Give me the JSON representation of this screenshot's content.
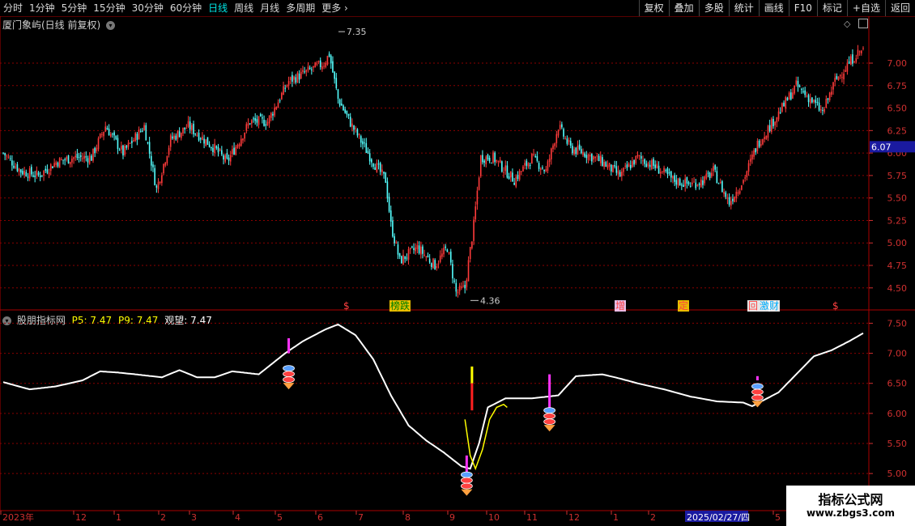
{
  "toolbar": {
    "periods": [
      "分时",
      "1分钟",
      "5分钟",
      "15分钟",
      "30分钟",
      "60分钟",
      "日线",
      "周线",
      "月线",
      "多周期",
      "更多"
    ],
    "active": "日线",
    "more_chevron": "›",
    "right_buttons": [
      "复权",
      "叠加",
      "多股",
      "统计",
      "画线",
      "F10",
      "标记",
      "+自选",
      "返回"
    ]
  },
  "main_panel": {
    "title": "厦门象屿(日线 前复权)",
    "price_labels": [
      "7.00",
      "6.75",
      "6.50",
      "6.25",
      "6.00",
      "5.75",
      "5.50",
      "5.25",
      "5.00",
      "4.75",
      "4.50"
    ],
    "current_price": "6.07",
    "high_label": "7.35",
    "low_label": "4.36",
    "markers": [
      "$",
      "榜跌",
      "增",
      "定",
      "回",
      "激",
      "财",
      "$"
    ]
  },
  "indicator_panel": {
    "name": "股朋指标网",
    "p5_label": "P5:",
    "p5": "7.47",
    "p9_label": "P9:",
    "p9": "7.47",
    "view_label": "观望:",
    "view": "7.47",
    "price_labels": [
      "7.50",
      "7.00",
      "6.50",
      "6.00",
      "5.50",
      "5.00"
    ]
  },
  "date_axis": {
    "labels": [
      "2023年",
      "12",
      "1",
      "2",
      "3",
      "4",
      "5",
      "6",
      "7",
      "8",
      "9",
      "10",
      "11",
      "12",
      "1",
      "2",
      "2025/02/27/四",
      "5"
    ]
  },
  "watermark": {
    "line1": "指标公式网",
    "line2": "www.zbgs3.com"
  },
  "colors": {
    "up": "#ff3b3b",
    "down": "#54ffff",
    "grid": "#8b0000",
    "axis_text": "#d03030",
    "indicator_line": "#ffffff",
    "signal_yellow": "#ffff00",
    "signal_magenta": "#ff33ff",
    "highlight_blue": "#1a1aa0"
  },
  "chart_data": {
    "type": "candlestick",
    "title": "厦门象屿(日线 前复权)",
    "ylim": [
      4.3,
      7.45
    ],
    "annotated_high": 7.35,
    "annotated_low": 4.36,
    "current_price": 6.07,
    "trend_points": [
      [
        0,
        6.0
      ],
      [
        10,
        5.8
      ],
      [
        20,
        5.75
      ],
      [
        30,
        5.9
      ],
      [
        40,
        5.95
      ],
      [
        50,
        5.95
      ],
      [
        58,
        6.3
      ],
      [
        68,
        6.0
      ],
      [
        80,
        6.3
      ],
      [
        87,
        5.6
      ],
      [
        95,
        6.15
      ],
      [
        105,
        6.3
      ],
      [
        120,
        6.05
      ],
      [
        127,
        5.9
      ],
      [
        140,
        6.35
      ],
      [
        150,
        6.35
      ],
      [
        162,
        6.8
      ],
      [
        172,
        6.9
      ],
      [
        182,
        7.0
      ],
      [
        185,
        7.1
      ],
      [
        190,
        6.6
      ],
      [
        198,
        6.3
      ],
      [
        210,
        5.9
      ],
      [
        217,
        5.7
      ],
      [
        220,
        5.2
      ],
      [
        225,
        4.8
      ],
      [
        235,
        4.95
      ],
      [
        245,
        4.75
      ],
      [
        252,
        4.95
      ],
      [
        257,
        4.45
      ],
      [
        262,
        4.5
      ],
      [
        267,
        5.2
      ],
      [
        271,
        5.95
      ],
      [
        278,
        5.95
      ],
      [
        290,
        5.7
      ],
      [
        300,
        5.95
      ],
      [
        308,
        5.8
      ],
      [
        315,
        6.3
      ],
      [
        322,
        6.05
      ],
      [
        330,
        6.0
      ],
      [
        340,
        5.9
      ],
      [
        350,
        5.75
      ],
      [
        360,
        5.95
      ],
      [
        370,
        5.85
      ],
      [
        380,
        5.7
      ],
      [
        390,
        5.65
      ],
      [
        398,
        5.7
      ],
      [
        403,
        5.8
      ],
      [
        408,
        5.6
      ],
      [
        412,
        5.45
      ],
      [
        420,
        5.7
      ],
      [
        428,
        6.1
      ],
      [
        435,
        6.3
      ],
      [
        442,
        6.5
      ],
      [
        450,
        6.75
      ],
      [
        458,
        6.6
      ],
      [
        465,
        6.45
      ],
      [
        472,
        6.8
      ],
      [
        478,
        6.95
      ],
      [
        484,
        7.1
      ],
      [
        488,
        7.15
      ]
    ],
    "indicator": {
      "name": "股朋指标网",
      "ylim": [
        4.8,
        7.6
      ],
      "P5": 7.47,
      "P9": 7.47,
      "观望": 7.47,
      "line_points": [
        [
          0,
          6.52
        ],
        [
          15,
          6.4
        ],
        [
          30,
          6.45
        ],
        [
          45,
          6.55
        ],
        [
          55,
          6.7
        ],
        [
          65,
          6.68
        ],
        [
          75,
          6.65
        ],
        [
          90,
          6.6
        ],
        [
          100,
          6.72
        ],
        [
          110,
          6.6
        ],
        [
          120,
          6.6
        ],
        [
          130,
          6.7
        ],
        [
          145,
          6.65
        ],
        [
          160,
          7.0
        ],
        [
          170,
          7.2
        ],
        [
          183,
          7.4
        ],
        [
          190,
          7.48
        ],
        [
          200,
          7.3
        ],
        [
          210,
          6.9
        ],
        [
          220,
          6.3
        ],
        [
          230,
          5.8
        ],
        [
          240,
          5.55
        ],
        [
          250,
          5.35
        ],
        [
          260,
          5.12
        ],
        [
          265,
          5.08
        ],
        [
          270,
          5.5
        ],
        [
          275,
          6.1
        ],
        [
          285,
          6.25
        ],
        [
          300,
          6.25
        ],
        [
          315,
          6.3
        ],
        [
          325,
          6.62
        ],
        [
          340,
          6.65
        ],
        [
          350,
          6.58
        ],
        [
          360,
          6.5
        ],
        [
          375,
          6.4
        ],
        [
          390,
          6.28
        ],
        [
          405,
          6.2
        ],
        [
          420,
          6.18
        ],
        [
          425,
          6.12
        ],
        [
          440,
          6.35
        ],
        [
          450,
          6.65
        ],
        [
          460,
          6.95
        ],
        [
          470,
          7.05
        ],
        [
          480,
          7.2
        ],
        [
          495,
          7.45
        ]
      ]
    }
  }
}
